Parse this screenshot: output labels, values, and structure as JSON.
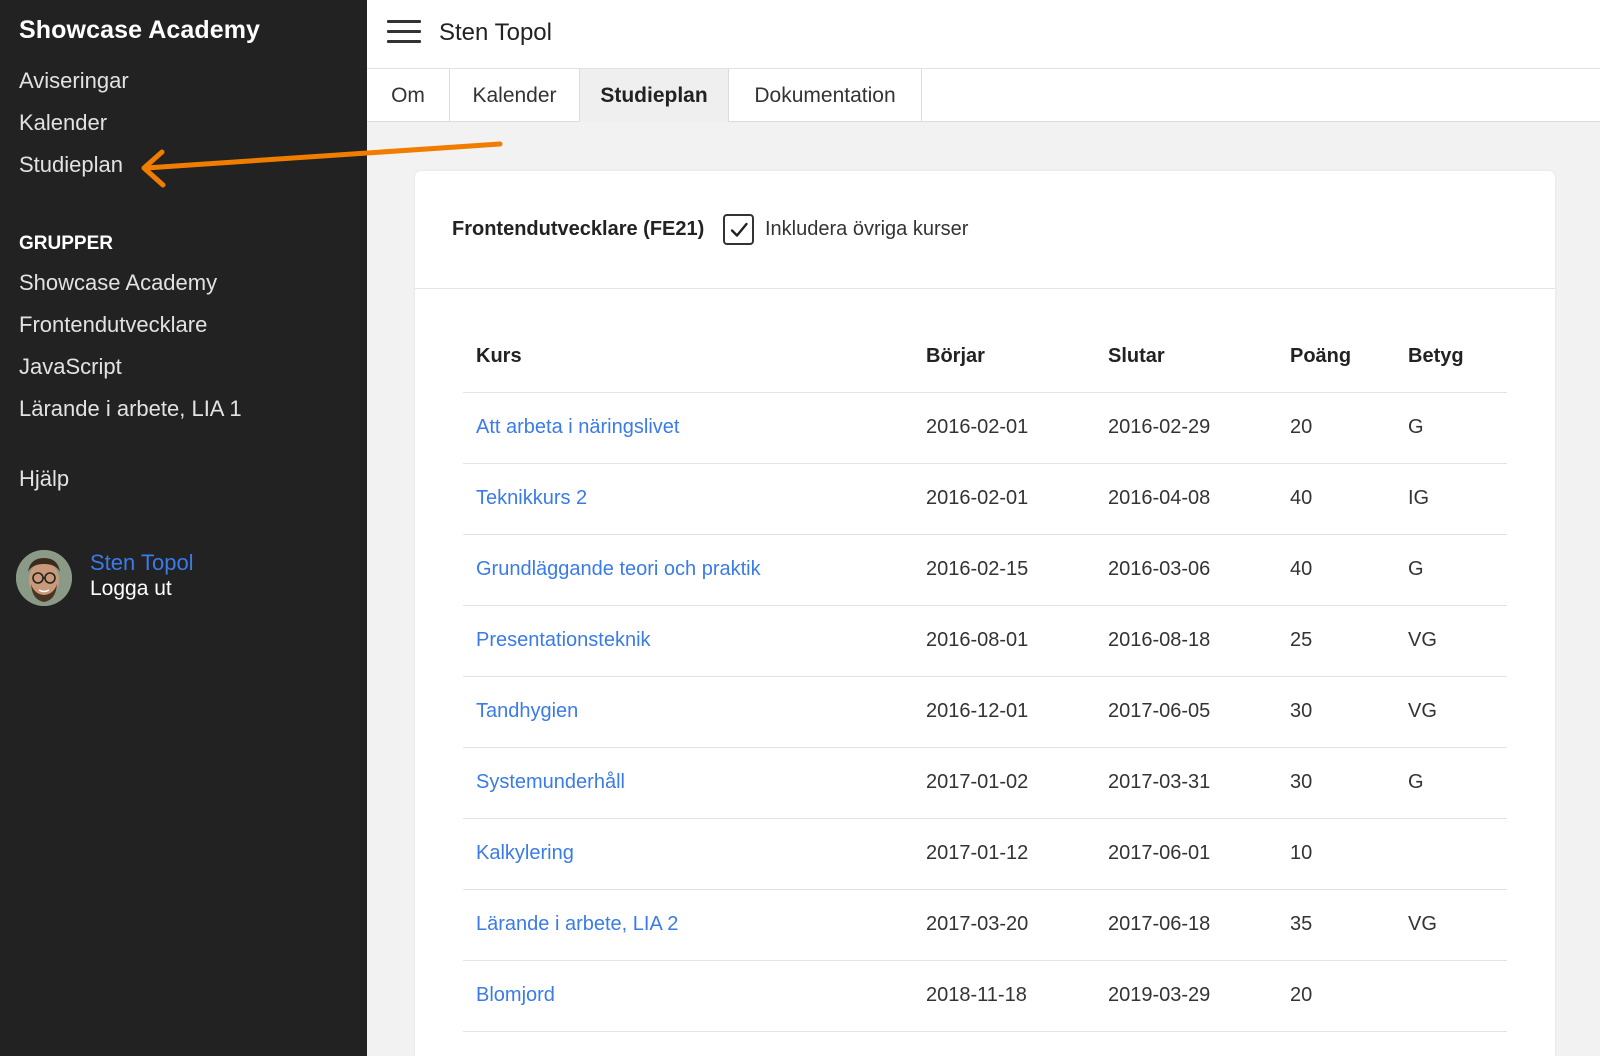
{
  "sidebar": {
    "brand": "Showcase Academy",
    "items": [
      {
        "label": "Aviseringar"
      },
      {
        "label": "Kalender"
      },
      {
        "label": "Studieplan"
      }
    ],
    "groups_heading": "GRUPPER",
    "groups": [
      {
        "label": "Showcase Academy"
      },
      {
        "label": "Frontendutvecklare"
      },
      {
        "label": "JavaScript"
      },
      {
        "label": "Lärande i arbete, LIA 1"
      }
    ],
    "help": "Hjälp",
    "user": {
      "name": "Sten Topol",
      "logout": "Logga ut"
    }
  },
  "header": {
    "title": "Sten Topol",
    "menu_icon": "hamburger-icon"
  },
  "tabs": [
    {
      "label": "Om"
    },
    {
      "label": "Kalender"
    },
    {
      "label": "Studieplan",
      "active": true
    },
    {
      "label": "Dokumentation"
    }
  ],
  "plan": {
    "program": "Frontendutvecklare (FE21)",
    "include_other_label": "Inkludera övriga kurser",
    "include_other_checked": true,
    "columns": [
      "Kurs",
      "Börjar",
      "Slutar",
      "Poäng",
      "Betyg"
    ],
    "rows": [
      {
        "course": "Att arbeta i näringslivet",
        "start": "2016-02-01",
        "end": "2016-02-29",
        "points": "20",
        "grade": "G"
      },
      {
        "course": "Teknikkurs 2",
        "start": "2016-02-01",
        "end": "2016-04-08",
        "points": "40",
        "grade": "IG"
      },
      {
        "course": "Grundläggande teori och praktik",
        "start": "2016-02-15",
        "end": "2016-03-06",
        "points": "40",
        "grade": "G"
      },
      {
        "course": "Presentationsteknik",
        "start": "2016-08-01",
        "end": "2016-08-18",
        "points": "25",
        "grade": "VG"
      },
      {
        "course": "Tandhygien",
        "start": "2016-12-01",
        "end": "2017-06-05",
        "points": "30",
        "grade": "VG"
      },
      {
        "course": "Systemunderhåll",
        "start": "2017-01-02",
        "end": "2017-03-31",
        "points": "30",
        "grade": "G"
      },
      {
        "course": "Kalkylering",
        "start": "2017-01-12",
        "end": "2017-06-01",
        "points": "10",
        "grade": ""
      },
      {
        "course": "Lärande i arbete, LIA 2",
        "start": "2017-03-20",
        "end": "2017-06-18",
        "points": "35",
        "grade": "VG"
      },
      {
        "course": "Blomjord",
        "start": "2018-11-18",
        "end": "2019-03-29",
        "points": "20",
        "grade": ""
      }
    ]
  },
  "colors": {
    "sidebar_bg": "#222222",
    "link": "#3a7be8",
    "annotation_arrow": "#f07d00"
  }
}
